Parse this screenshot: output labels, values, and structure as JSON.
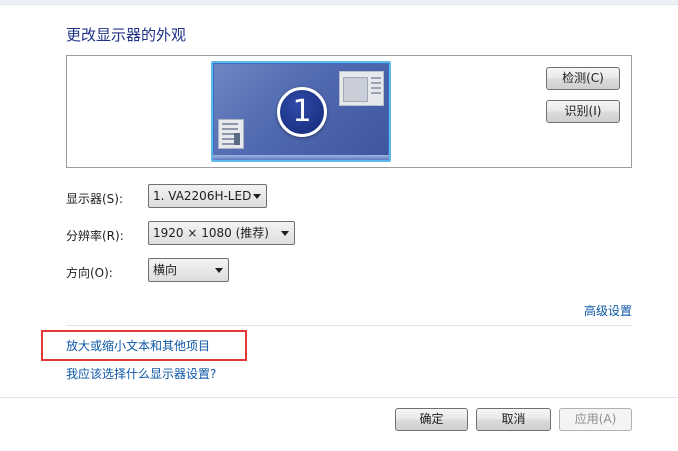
{
  "page": {
    "title": "更改显示器的外观"
  },
  "preview": {
    "monitor_number": "1",
    "detect_label": "检测(C)",
    "identify_label": "识别(I)"
  },
  "settings": {
    "display": {
      "label": "显示器(S):",
      "value": "1. VA2206H-LED"
    },
    "resolution": {
      "label": "分辨率(R):",
      "value": "1920 × 1080 (推荐)"
    },
    "orientation": {
      "label": "方向(O):",
      "value": "横向"
    }
  },
  "links": {
    "advanced": "高级设置",
    "resize_text": "放大或缩小文本和其他项目",
    "which_settings": "我应该选择什么显示器设置?"
  },
  "footer": {
    "ok_label": "确定",
    "cancel_label": "取消",
    "apply_label": "应用(A)"
  },
  "colors": {
    "title": "#1e3287",
    "link": "#0d57a6",
    "highlight": "#e23a36",
    "monitor_border": "#5fb7ea"
  }
}
